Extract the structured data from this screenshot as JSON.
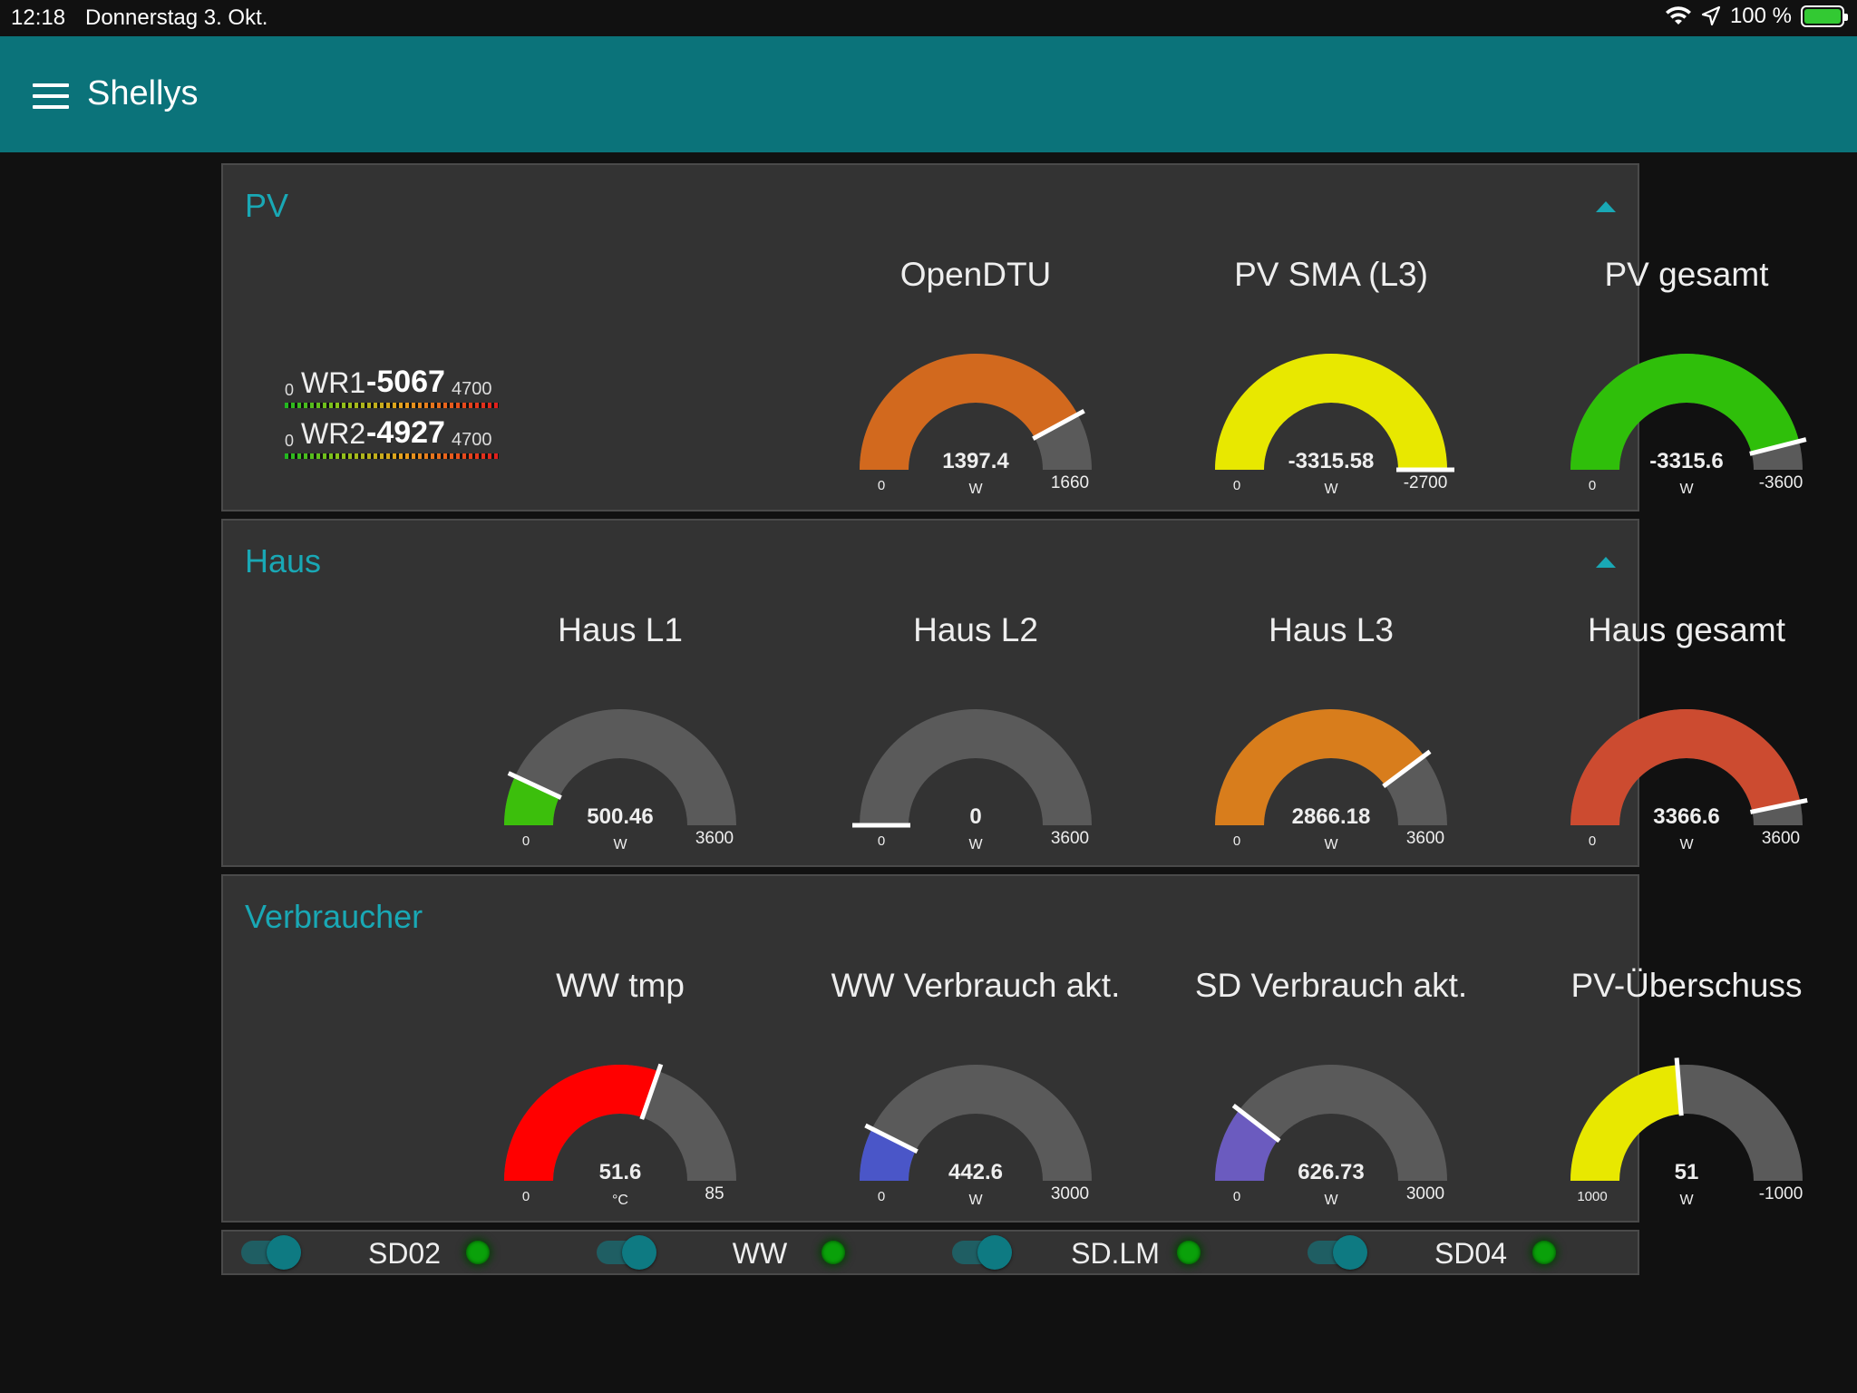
{
  "status_bar": {
    "time": "12:18",
    "date": "Donnerstag 3. Okt.",
    "battery": "100 %",
    "icons": [
      "wifi-icon",
      "location-arrow-icon",
      "battery-charging-icon"
    ]
  },
  "app": {
    "title": "Shellys",
    "accent": "#0b737a",
    "group_title_color": "#19a8b5"
  },
  "pv": {
    "title": "PV",
    "wr": [
      {
        "min": "0",
        "name": "WR1",
        "value": "-5067",
        "max": "4700",
        "level": 0.0
      },
      {
        "min": "0",
        "name": "WR2",
        "value": "-4927",
        "max": "4700",
        "level": 0.0
      }
    ],
    "gauges": [
      {
        "title": "OpenDTU",
        "value": "1397.4",
        "unit": "W",
        "min": "0",
        "max": "1660",
        "fraction": 0.842,
        "color": "#d2691e"
      },
      {
        "title": "PV SMA (L3)",
        "value": "-3315.58",
        "unit": "W",
        "min": "0",
        "max": "-2700",
        "fraction": 1.0,
        "color": "#e8e800"
      },
      {
        "title": "PV gesamt",
        "value": "-3315.6",
        "unit": "W",
        "min": "0",
        "max": "-3600",
        "fraction": 0.921,
        "color": "#2fbf0a"
      }
    ]
  },
  "haus": {
    "title": "Haus",
    "gauges": [
      {
        "title": "Haus L1",
        "value": "500.46",
        "unit": "W",
        "min": "0",
        "max": "3600",
        "fraction": 0.139,
        "color": "#3cbf0c"
      },
      {
        "title": "Haus L2",
        "value": "0",
        "unit": "W",
        "min": "0",
        "max": "3600",
        "fraction": 0.0,
        "color": "#3cbf0c"
      },
      {
        "title": "Haus L3",
        "value": "2866.18",
        "unit": "W",
        "min": "0",
        "max": "3600",
        "fraction": 0.796,
        "color": "#d87d1c"
      },
      {
        "title": "Haus gesamt",
        "value": "3366.6",
        "unit": "W",
        "min": "0",
        "max": "3600",
        "fraction": 0.935,
        "color": "#cc4b30"
      }
    ]
  },
  "verbraucher": {
    "title": "Verbraucher",
    "gauges": [
      {
        "title": "WW tmp",
        "value": "51.6",
        "unit": "°C",
        "min": "0",
        "max": "85",
        "fraction": 0.607,
        "color": "#ff0000"
      },
      {
        "title": "WW Verbrauch akt.",
        "value": "442.6",
        "unit": "W",
        "min": "0",
        "max": "3000",
        "fraction": 0.148,
        "color": "#4a56c8"
      },
      {
        "title": "SD Verbrauch akt.",
        "value": "626.73",
        "unit": "W",
        "min": "0",
        "max": "3000",
        "fraction": 0.209,
        "color": "#6b5bbf"
      },
      {
        "title": "PV-Überschuss",
        "value": "51",
        "unit": "W",
        "min": "1000",
        "max": "-1000",
        "fraction": 0.4745,
        "color": "#e8e800"
      }
    ]
  },
  "switches": [
    {
      "label": "SD02",
      "on": true
    },
    {
      "label": "WW",
      "on": true
    },
    {
      "label": "SD.LM",
      "on": true
    },
    {
      "label": "SD04",
      "on": true
    }
  ]
}
